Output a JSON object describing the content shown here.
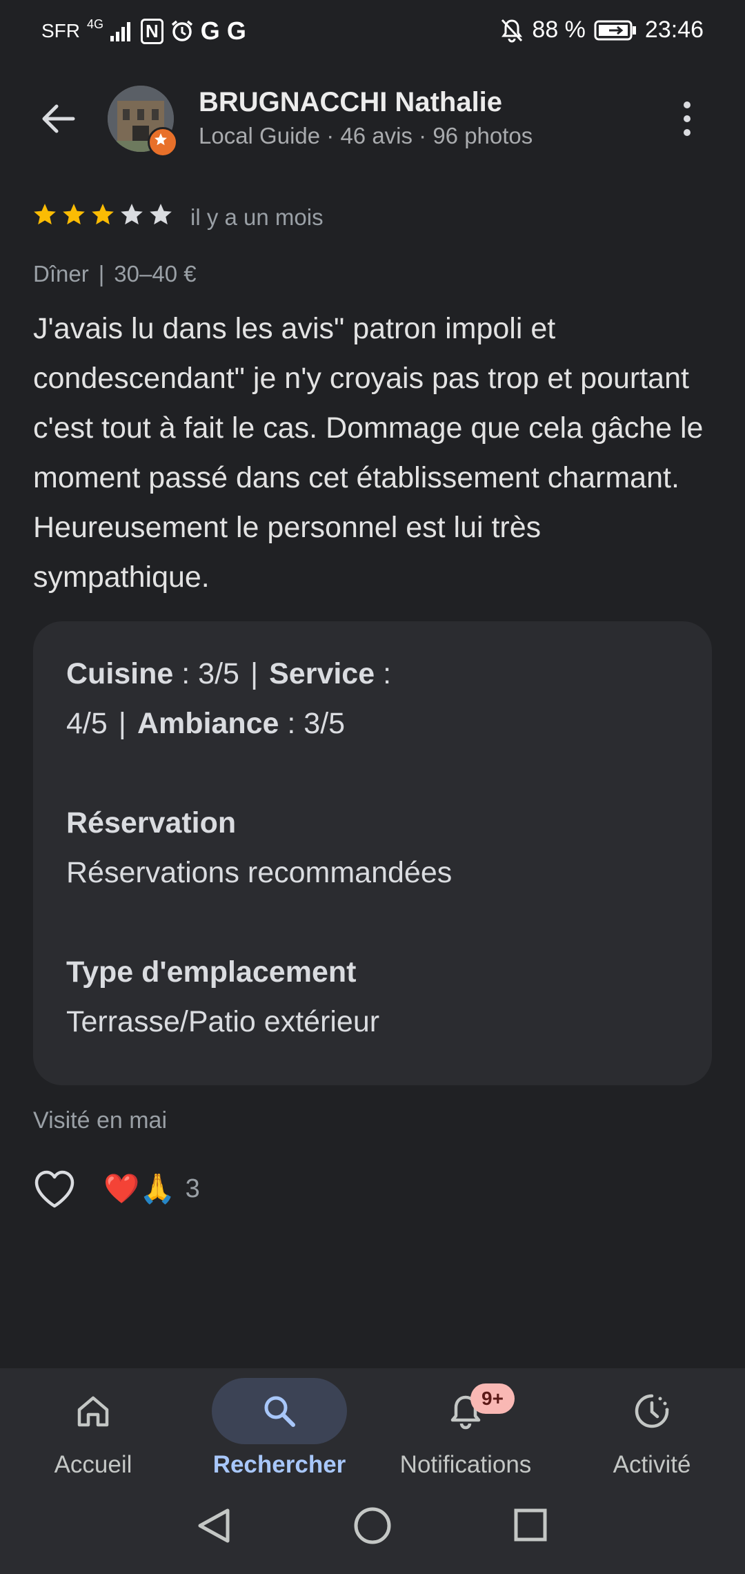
{
  "status_bar": {
    "carrier": "SFR",
    "network": "4G",
    "nfc": "N",
    "google_1": "G",
    "google_2": "G",
    "battery": "88 %",
    "time": "23:46"
  },
  "header": {
    "reviewer_name": "BRUGNACCHI Nathalie",
    "reviewer_meta": "Local Guide · 46 avis · 96 photos"
  },
  "review": {
    "rating": 3,
    "max_rating": 5,
    "date": "il y a un mois",
    "meal": "Dîner",
    "price": "30–40 €",
    "text": "J'avais lu dans les avis\" patron impoli et condescendant\" je n'y croyais pas trop et pourtant c'est tout à fait le cas. Dommage que cela gâche le moment passé dans cet établissement charmant. Heureusement le personnel est lui très sympathique.",
    "details": {
      "cuisine_label": "Cuisine",
      "cuisine_value": " : 3/5",
      "service_label": "Service",
      "service_value_a": " :",
      "service_value_b": "4/5",
      "ambiance_label": "Ambiance",
      "ambiance_value": " : 3/5",
      "reservation_title": "Réservation",
      "reservation_value": "Réservations recommandées",
      "location_title": "Type d'emplacement",
      "location_value": "Terrasse/Patio extérieur"
    },
    "visited": "Visité en mai",
    "reactions_emoji": "❤️🙏",
    "reactions_count": "3"
  },
  "nav": {
    "items": [
      {
        "label": "Accueil",
        "icon": "home-icon"
      },
      {
        "label": "Rechercher",
        "icon": "search-icon",
        "active": true
      },
      {
        "label": "Notifications",
        "icon": "bell-icon",
        "badge": "9+"
      },
      {
        "label": "Activité",
        "icon": "activity-icon"
      }
    ]
  },
  "colors": {
    "background": "#202124",
    "card": "#2b2c30",
    "star_filled": "#fbbc04",
    "active_nav": "#a8c7fa",
    "guide_badge": "#e8702a"
  }
}
